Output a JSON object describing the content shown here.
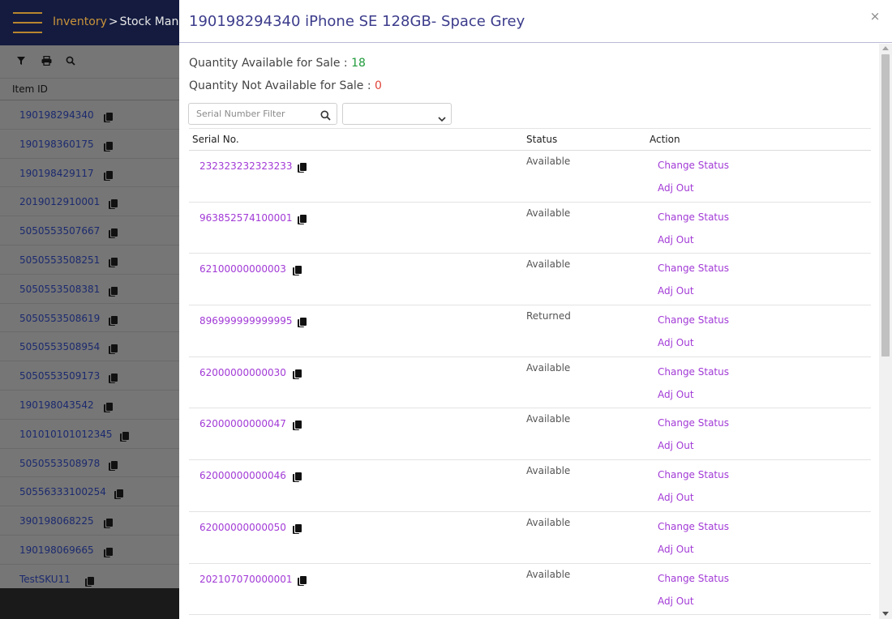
{
  "nav": {
    "breadcrumb_root": "Inventory",
    "breadcrumb_separator": ">",
    "breadcrumb_current": "Stock Mana"
  },
  "list": {
    "column_header": "Item ID",
    "items": [
      "190198294340",
      "190198360175",
      "190198429117",
      "2019012910001",
      "5050553507667",
      "5050553508251",
      "5050553508381",
      "5050553508619",
      "5050553508954",
      "5050553509173",
      "190198043542",
      "101010101012345",
      "5050553508978",
      "50556333100254",
      "390198068225",
      "190198069665",
      "TestSKU11"
    ]
  },
  "modal": {
    "title": "190198294340 iPhone SE 128GB- Space Grey",
    "close_label": "×",
    "qty_available_label": "Quantity Available for Sale : ",
    "qty_available_value": "18",
    "qty_not_available_label": "Quantity Not Available for Sale : ",
    "qty_not_available_value": "0",
    "filter_placeholder": "Serial Number Filter",
    "status_select_value": ""
  },
  "table": {
    "headers": {
      "serial": "Serial No.",
      "status": "Status",
      "action": "Action"
    },
    "rows": [
      {
        "serial": "232323232323233",
        "status": "Available",
        "change": "Change Status",
        "adj": "Adj Out"
      },
      {
        "serial": "963852574100001",
        "status": "Available",
        "change": "Change Status",
        "adj": "Adj Out"
      },
      {
        "serial": "62100000000003",
        "status": "Available",
        "change": "Change Status",
        "adj": "Adj Out"
      },
      {
        "serial": "896999999999995",
        "status": "Returned",
        "change": "Change Status",
        "adj": "Adj Out"
      },
      {
        "serial": "62000000000030",
        "status": "Available",
        "change": "Change Status",
        "adj": "Adj Out"
      },
      {
        "serial": "62000000000047",
        "status": "Available",
        "change": "Change Status",
        "adj": "Adj Out"
      },
      {
        "serial": "62000000000046",
        "status": "Available",
        "change": "Change Status",
        "adj": "Adj Out"
      },
      {
        "serial": "62000000000050",
        "status": "Available",
        "change": "Change Status",
        "adj": "Adj Out"
      },
      {
        "serial": "202107070000001",
        "status": "Available",
        "change": "Change Status",
        "adj": "Adj Out"
      }
    ]
  },
  "icons": {
    "menu": "hamburger-menu-icon",
    "filter": "filter-icon",
    "print": "print-icon",
    "search": "search-icon",
    "copy": "copy-icon",
    "close": "close-icon",
    "dropdown": "chevron-down-icon"
  },
  "colors": {
    "topbar": "#141b3f",
    "breadcrumb_link": "#c9933a",
    "title": "#3c3c8c",
    "link": "#a23ad6",
    "available_value": "#1f9b3a",
    "not_available_value": "#e0443a"
  }
}
